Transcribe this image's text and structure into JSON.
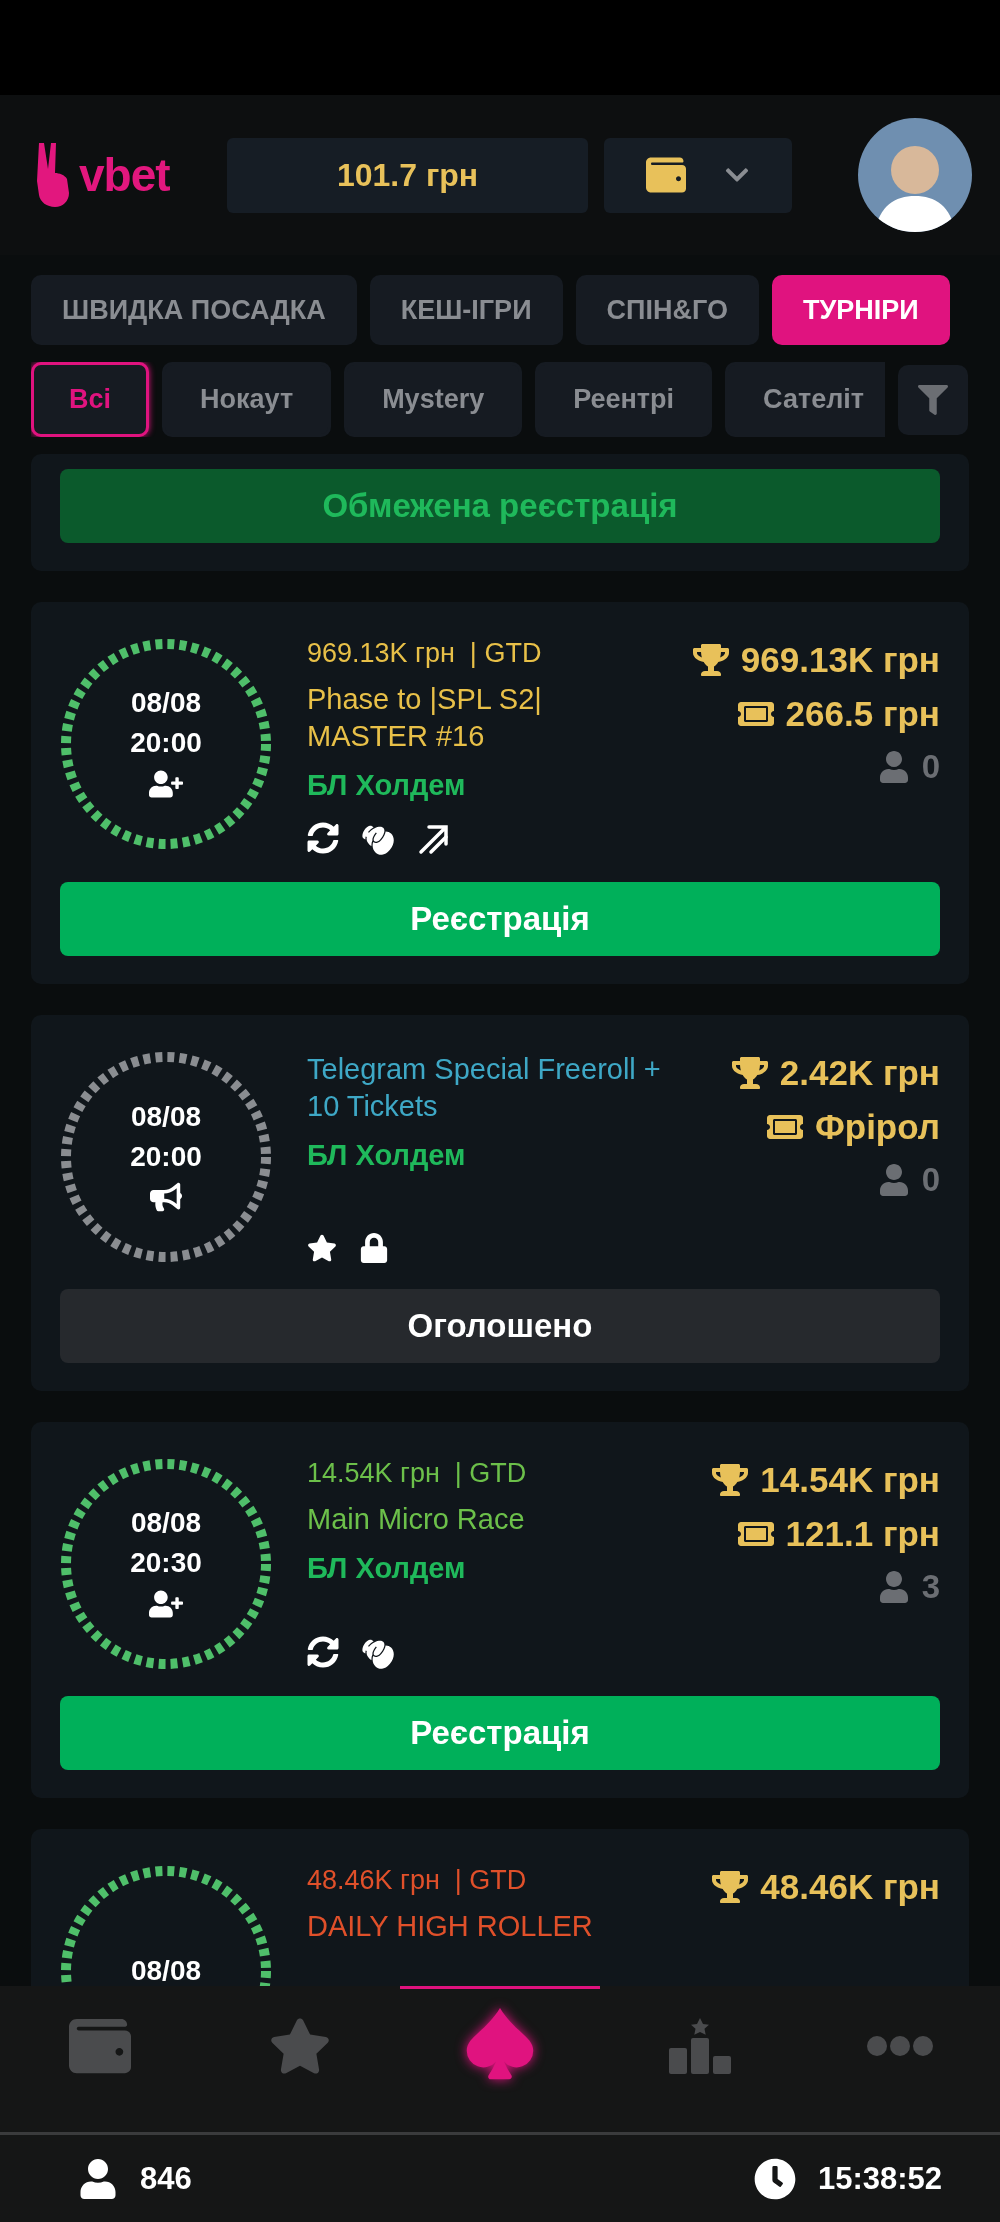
{
  "logo": "vbet",
  "balance": "101.7 грн",
  "game_tabs": [
    {
      "label": "ШВИДКА ПОСАДКА",
      "selected": false
    },
    {
      "label": "КЕШ-ІГРИ",
      "selected": false
    },
    {
      "label": "СПІН&ГО",
      "selected": false
    },
    {
      "label": "ТУРНІРИ",
      "selected": true
    }
  ],
  "filters": [
    {
      "label": "Всі",
      "selected": true
    },
    {
      "label": "Нокаут",
      "selected": false
    },
    {
      "label": "Mystery",
      "selected": false
    },
    {
      "label": "Реентрі",
      "selected": false
    },
    {
      "label": "Сателіт",
      "selected": false
    }
  ],
  "tournaments": [
    {
      "kind": "partial",
      "button": {
        "label": "Обмежена реєстрація",
        "kind": "limited"
      }
    },
    {
      "kind": "registering",
      "date": "08/08",
      "time": "20:00",
      "color": "#e8c048",
      "guarantee": "969.13K грн  | GTD",
      "title_lines": [
        "Phase to |SPL S2|",
        "MASTER #16"
      ],
      "game": "БЛ Холдем",
      "features": [
        {
          "kind": "reentry"
        },
        {
          "kind": "knockout"
        },
        {
          "kind": "progressive"
        }
      ],
      "prize": "969.13K грн",
      "buy_in": "266.5 грн",
      "players": "0",
      "button": {
        "label": "Реєстрація",
        "kind": "register"
      }
    },
    {
      "kind": "announced",
      "date": "08/08",
      "time": "20:00",
      "color": "#3ea8c6",
      "title_lines": [
        "Telegram Special Freeroll +",
        "10 Tickets"
      ],
      "game": "БЛ Холдем",
      "features": [
        {
          "kind": "favorite"
        },
        {
          "kind": "private"
        }
      ],
      "prize": "2.42K грн",
      "buy_in": "Фрірол",
      "players": "0",
      "button": {
        "label": "Оголошено",
        "kind": "announced"
      }
    },
    {
      "kind": "registering",
      "date": "08/08",
      "time": "20:30",
      "color": "#6cc04a",
      "guarantee": "14.54K грн  | GTD",
      "title_lines": [
        "Main Micro Race"
      ],
      "game": "БЛ Холдем",
      "features": [
        {
          "kind": "reentry"
        },
        {
          "kind": "knockout"
        }
      ],
      "prize": "14.54K грн",
      "buy_in": "121.1 грн",
      "players": "3",
      "button": {
        "label": "Реєстрація",
        "kind": "register"
      }
    },
    {
      "kind": "registering",
      "date": "08/08",
      "color": "#e0502a",
      "guarantee": "48.46K грн  | GTD",
      "title_lines": [
        "DAILY HIGH ROLLER"
      ],
      "prize": "48.46K грн"
    }
  ],
  "bottom_nav": [
    {
      "kind": "wallet",
      "selected": false
    },
    {
      "kind": "favorites",
      "selected": false
    },
    {
      "kind": "poker",
      "selected": true
    },
    {
      "kind": "leaderboard",
      "selected": false
    },
    {
      "kind": "more",
      "selected": false
    }
  ],
  "status_bar": {
    "online": "846",
    "clock": "15:38:52"
  }
}
